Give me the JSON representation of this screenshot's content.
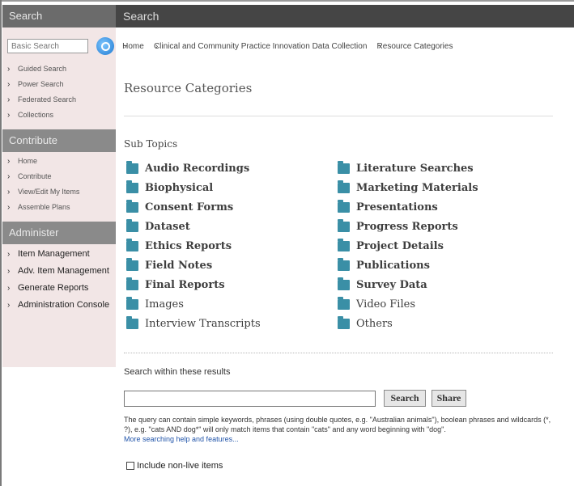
{
  "sidebar": {
    "search_header": "Search",
    "basic_search_placeholder": "Basic Search",
    "search_links": [
      "Guided Search",
      "Power Search",
      "Federated Search",
      "Collections"
    ],
    "contribute_header": "Contribute",
    "contribute_links": [
      "Home",
      "Contribute",
      "View/Edit My Items",
      "Assemble Plans"
    ],
    "administer_header": "Administer",
    "administer_links": [
      "Item Management",
      "Adv. Item Management",
      "Generate Reports",
      "Administration Console"
    ]
  },
  "main": {
    "header": "Search",
    "breadcrumb": [
      "Home",
      "Clinical and Community Practice Innovation Data Collection",
      "Resource Categories"
    ],
    "title": "Resource Categories",
    "subtopics_title": "Sub Topics",
    "topics_left": [
      "Audio Recordings",
      "Biophysical",
      "Consent Forms",
      "Dataset",
      "Ethics Reports",
      "Field Notes",
      "Final Reports",
      "Images",
      "Interview Transcripts"
    ],
    "topics_right": [
      "Literature Searches",
      "Marketing Materials",
      "Presentations",
      "Progress Reports",
      "Project Details",
      "Publications",
      "Survey Data",
      "Video Files",
      "Others"
    ],
    "search_within_label": "Search within these results",
    "search_value": "",
    "search_button": "Search",
    "share_button": "Share",
    "help_text": "The query can contain simple keywords, phrases (using double quotes, e.g. \"Australian animals\"), boolean phrases and wildcards (*, ?), e.g. \"cats AND dog*\" will only match items that contain \"cats\" and any word beginning with \"dog\".",
    "help_link": "More searching help and features...",
    "include_nonlive_label": "Include non-live items",
    "include_nonlive_checked": false
  }
}
